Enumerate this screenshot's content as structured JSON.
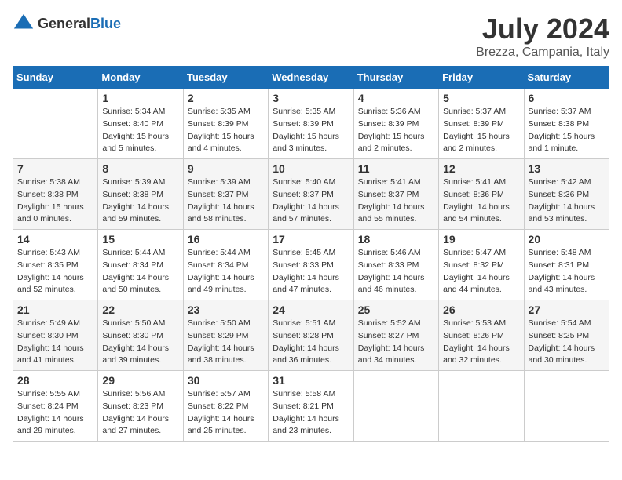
{
  "header": {
    "logo_general": "General",
    "logo_blue": "Blue",
    "month_year": "July 2024",
    "location": "Brezza, Campania, Italy"
  },
  "days_of_week": [
    "Sunday",
    "Monday",
    "Tuesday",
    "Wednesday",
    "Thursday",
    "Friday",
    "Saturday"
  ],
  "weeks": [
    [
      {
        "day": "",
        "info": ""
      },
      {
        "day": "1",
        "info": "Sunrise: 5:34 AM\nSunset: 8:40 PM\nDaylight: 15 hours\nand 5 minutes."
      },
      {
        "day": "2",
        "info": "Sunrise: 5:35 AM\nSunset: 8:39 PM\nDaylight: 15 hours\nand 4 minutes."
      },
      {
        "day": "3",
        "info": "Sunrise: 5:35 AM\nSunset: 8:39 PM\nDaylight: 15 hours\nand 3 minutes."
      },
      {
        "day": "4",
        "info": "Sunrise: 5:36 AM\nSunset: 8:39 PM\nDaylight: 15 hours\nand 2 minutes."
      },
      {
        "day": "5",
        "info": "Sunrise: 5:37 AM\nSunset: 8:39 PM\nDaylight: 15 hours\nand 2 minutes."
      },
      {
        "day": "6",
        "info": "Sunrise: 5:37 AM\nSunset: 8:38 PM\nDaylight: 15 hours\nand 1 minute."
      }
    ],
    [
      {
        "day": "7",
        "info": "Sunrise: 5:38 AM\nSunset: 8:38 PM\nDaylight: 15 hours\nand 0 minutes."
      },
      {
        "day": "8",
        "info": "Sunrise: 5:39 AM\nSunset: 8:38 PM\nDaylight: 14 hours\nand 59 minutes."
      },
      {
        "day": "9",
        "info": "Sunrise: 5:39 AM\nSunset: 8:37 PM\nDaylight: 14 hours\nand 58 minutes."
      },
      {
        "day": "10",
        "info": "Sunrise: 5:40 AM\nSunset: 8:37 PM\nDaylight: 14 hours\nand 57 minutes."
      },
      {
        "day": "11",
        "info": "Sunrise: 5:41 AM\nSunset: 8:37 PM\nDaylight: 14 hours\nand 55 minutes."
      },
      {
        "day": "12",
        "info": "Sunrise: 5:41 AM\nSunset: 8:36 PM\nDaylight: 14 hours\nand 54 minutes."
      },
      {
        "day": "13",
        "info": "Sunrise: 5:42 AM\nSunset: 8:36 PM\nDaylight: 14 hours\nand 53 minutes."
      }
    ],
    [
      {
        "day": "14",
        "info": "Sunrise: 5:43 AM\nSunset: 8:35 PM\nDaylight: 14 hours\nand 52 minutes."
      },
      {
        "day": "15",
        "info": "Sunrise: 5:44 AM\nSunset: 8:34 PM\nDaylight: 14 hours\nand 50 minutes."
      },
      {
        "day": "16",
        "info": "Sunrise: 5:44 AM\nSunset: 8:34 PM\nDaylight: 14 hours\nand 49 minutes."
      },
      {
        "day": "17",
        "info": "Sunrise: 5:45 AM\nSunset: 8:33 PM\nDaylight: 14 hours\nand 47 minutes."
      },
      {
        "day": "18",
        "info": "Sunrise: 5:46 AM\nSunset: 8:33 PM\nDaylight: 14 hours\nand 46 minutes."
      },
      {
        "day": "19",
        "info": "Sunrise: 5:47 AM\nSunset: 8:32 PM\nDaylight: 14 hours\nand 44 minutes."
      },
      {
        "day": "20",
        "info": "Sunrise: 5:48 AM\nSunset: 8:31 PM\nDaylight: 14 hours\nand 43 minutes."
      }
    ],
    [
      {
        "day": "21",
        "info": "Sunrise: 5:49 AM\nSunset: 8:30 PM\nDaylight: 14 hours\nand 41 minutes."
      },
      {
        "day": "22",
        "info": "Sunrise: 5:50 AM\nSunset: 8:30 PM\nDaylight: 14 hours\nand 39 minutes."
      },
      {
        "day": "23",
        "info": "Sunrise: 5:50 AM\nSunset: 8:29 PM\nDaylight: 14 hours\nand 38 minutes."
      },
      {
        "day": "24",
        "info": "Sunrise: 5:51 AM\nSunset: 8:28 PM\nDaylight: 14 hours\nand 36 minutes."
      },
      {
        "day": "25",
        "info": "Sunrise: 5:52 AM\nSunset: 8:27 PM\nDaylight: 14 hours\nand 34 minutes."
      },
      {
        "day": "26",
        "info": "Sunrise: 5:53 AM\nSunset: 8:26 PM\nDaylight: 14 hours\nand 32 minutes."
      },
      {
        "day": "27",
        "info": "Sunrise: 5:54 AM\nSunset: 8:25 PM\nDaylight: 14 hours\nand 30 minutes."
      }
    ],
    [
      {
        "day": "28",
        "info": "Sunrise: 5:55 AM\nSunset: 8:24 PM\nDaylight: 14 hours\nand 29 minutes."
      },
      {
        "day": "29",
        "info": "Sunrise: 5:56 AM\nSunset: 8:23 PM\nDaylight: 14 hours\nand 27 minutes."
      },
      {
        "day": "30",
        "info": "Sunrise: 5:57 AM\nSunset: 8:22 PM\nDaylight: 14 hours\nand 25 minutes."
      },
      {
        "day": "31",
        "info": "Sunrise: 5:58 AM\nSunset: 8:21 PM\nDaylight: 14 hours\nand 23 minutes."
      },
      {
        "day": "",
        "info": ""
      },
      {
        "day": "",
        "info": ""
      },
      {
        "day": "",
        "info": ""
      }
    ]
  ]
}
